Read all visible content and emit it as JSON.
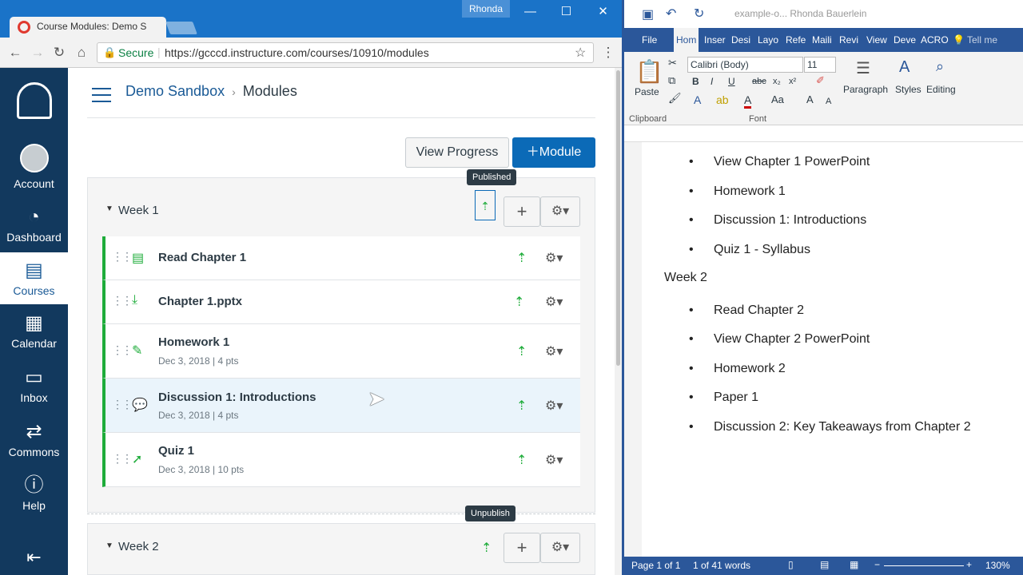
{
  "browser": {
    "tab_title": "Course Modules: Demo S",
    "profile": "Rhonda",
    "secure_label": "Secure",
    "url": "https://gcccd.instructure.com/courses/10910/modules"
  },
  "global_nav": {
    "items": [
      {
        "label": "Account"
      },
      {
        "label": "Dashboard"
      },
      {
        "label": "Courses"
      },
      {
        "label": "Calendar"
      },
      {
        "label": "Inbox"
      },
      {
        "label": "Commons"
      },
      {
        "label": "Help"
      }
    ]
  },
  "breadcrumb": {
    "course": "Demo Sandbox",
    "separator": "›",
    "page": "Modules"
  },
  "actions": {
    "view_progress": "View Progress",
    "add_module": "Module"
  },
  "tooltips": {
    "published": "Published",
    "unpublish": "Unpublish"
  },
  "modules": [
    {
      "title": "Week 1",
      "items": [
        {
          "title": "Read Chapter 1",
          "meta": ""
        },
        {
          "title": "Chapter 1.pptx",
          "meta": ""
        },
        {
          "title": "Homework 1",
          "meta": "Dec 3, 2018  |  4 pts"
        },
        {
          "title": "Discussion 1: Introductions",
          "meta": "Dec 3, 2018  |  4 pts"
        },
        {
          "title": "Quiz 1",
          "meta": "Dec 3, 2018  |  10 pts"
        }
      ]
    },
    {
      "title": "Week 2"
    }
  ],
  "word": {
    "title": "example-o...  Rhonda Bauerlein",
    "tabs": [
      "File",
      "Hom",
      "Inser",
      "Desi",
      "Layo",
      "Refe",
      "Maili",
      "Revi",
      "View",
      "Deve",
      "ACRO",
      "Tell me"
    ],
    "font_name": "Calibri (Body)",
    "font_size": "11",
    "groups": {
      "clipboard": "Clipboard",
      "font": "Font",
      "paste": "Paste",
      "paragraph": "Paragraph",
      "styles": "Styles",
      "editing": "Editing"
    },
    "doc": {
      "week1_items": [
        "View Chapter 1 PowerPoint",
        "Homework 1",
        "Discussion 1: Introductions",
        "Quiz 1 - Syllabus"
      ],
      "week2_heading": "Week 2",
      "week2_items": [
        "Read Chapter 2",
        "View Chapter 2 PowerPoint",
        "Homework 2",
        "Paper 1",
        "Discussion 2: Key Takeaways from Chapter 2"
      ]
    },
    "status": {
      "page": "Page 1 of 1",
      "words": "1 of 41 words",
      "zoom": "130%"
    }
  }
}
